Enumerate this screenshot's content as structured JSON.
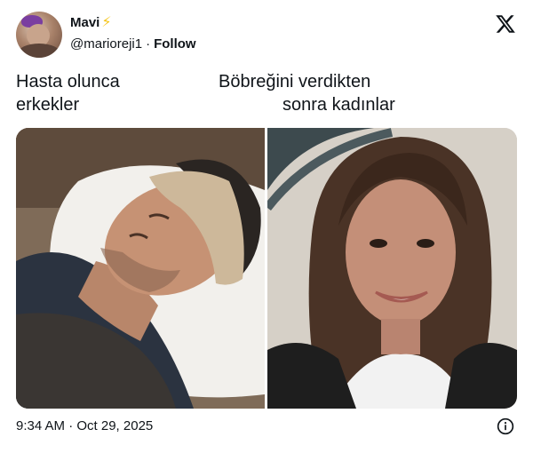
{
  "post": {
    "author": {
      "name": "Mavi",
      "handle": "@marioreji1",
      "separator": "·",
      "follow_label": "Follow",
      "badge_icon": "lightning-bolt-icon"
    },
    "platform_icon": "x-logo-icon",
    "caption": {
      "left_line1": "Hasta olunca",
      "left_line2": "erkekler",
      "right_line1": "Böbreğini verdikten",
      "right_line2": "sonra kadınlar"
    },
    "images": [
      {
        "description_icon": "photo-man-sick-in-bed"
      },
      {
        "description_icon": "photo-woman-smiling"
      }
    ],
    "timestamp": "9:34 AM · Oct 29, 2025",
    "info_icon": "info-icon"
  },
  "colors": {
    "text_primary": "#0f1419",
    "bolt": "#f5c518",
    "background": "#ffffff"
  }
}
